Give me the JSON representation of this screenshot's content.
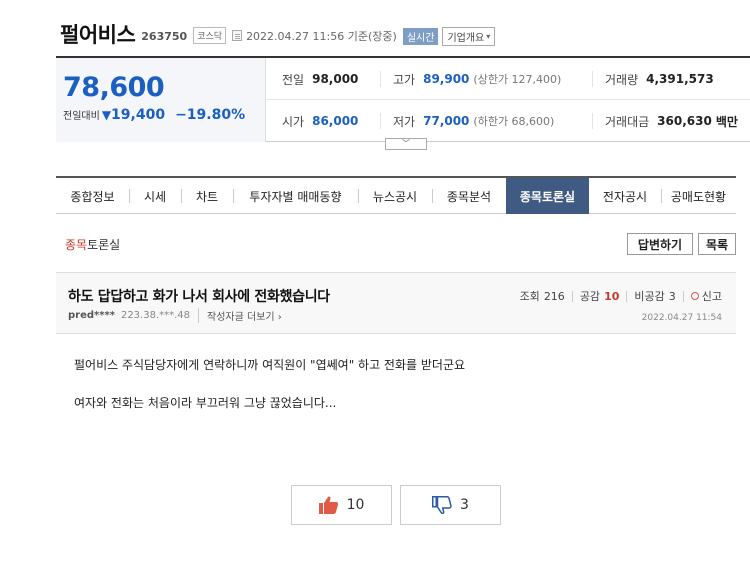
{
  "header": {
    "stock_name": "펄어비스",
    "stock_code": "263750",
    "market": "코스닥",
    "datetime": "2022.04.27 11:56",
    "basis": "기준(장중)",
    "realtime_badge": "실시간",
    "company_info_label": "기업개요"
  },
  "price": {
    "current": "78,600",
    "diff_label": "전일대비",
    "diff_arrow": "▼",
    "diff_value": "19,400",
    "diff_pct": "−19.80%",
    "prev_close_label": "전일",
    "prev_close": "98,000",
    "high_label": "고가",
    "high": "89,900",
    "upper_limit": "(상한가 127,400)",
    "volume_label": "거래량",
    "volume": "4,391,573",
    "open_label": "시가",
    "open": "86,000",
    "low_label": "저가",
    "low": "77,000",
    "lower_limit": "(하한가 68,600)",
    "amount_label": "거래대금",
    "amount": "360,630",
    "amount_unit": "백만"
  },
  "tabs": [
    {
      "label": "종합정보",
      "width": 73
    },
    {
      "label": "시세",
      "width": 52
    },
    {
      "label": "차트",
      "width": 52
    },
    {
      "label": "투자자별 매매동향",
      "width": 125
    },
    {
      "label": "뉴스공시",
      "width": 74
    },
    {
      "label": "종목분석",
      "width": 74
    },
    {
      "label": "종목토론실",
      "width": 83,
      "active": true
    },
    {
      "label": "전자공시",
      "width": 72
    },
    {
      "label": "공매도현황",
      "width": 75
    }
  ],
  "section": {
    "title_accent": "종목",
    "title_rest": "토론실",
    "reply_button": "답변하기",
    "list_button": "목록"
  },
  "post": {
    "title": "하도 답답하고 화가 나서 회사에 전화했습니다",
    "views_label": "조회",
    "views": "216",
    "likes_label": "공감",
    "likes": "10",
    "dislikes_label": "비공감",
    "dislikes": "3",
    "report_label": "신고",
    "author": "pred****",
    "ip": "223.38.***.48",
    "more_posts": "작성자글 더보기 ›",
    "date": "2022.04.27 11:54",
    "body": [
      "펄어비스 주식담당자에게 연락하니까 여직원이 \"엽쎄여\" 하고 전화를 받더군요",
      "여자와 전화는 처음이라 부끄러워 그냥 끊었습니다..."
    ]
  },
  "votes": {
    "like_count": "10",
    "dislike_count": "3"
  },
  "colors": {
    "price_blue": "#1a5fc1",
    "tab_active": "#3f5a83",
    "accent_red": "#c0392b",
    "like_red": "#e05a47",
    "dislike_blue": "#2a5aa8"
  }
}
